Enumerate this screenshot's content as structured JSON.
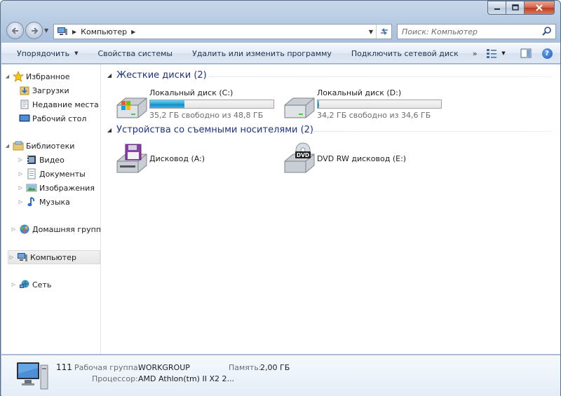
{
  "window": {
    "caption_buttons": [
      "minimize",
      "maximize",
      "close"
    ]
  },
  "address_bar": {
    "crumbs": [
      "Компьютер"
    ]
  },
  "search": {
    "placeholder": "Поиск: Компьютер"
  },
  "toolbar": {
    "organize": "Упорядочить",
    "system_properties": "Свойства системы",
    "uninstall": "Удалить или изменить программу",
    "map_drive": "Подключить сетевой диск",
    "more": "»"
  },
  "nav_pane": {
    "favorites": {
      "label": "Избранное",
      "items": [
        "Загрузки",
        "Недавние места",
        "Рабочий стол"
      ]
    },
    "libraries": {
      "label": "Библиотеки",
      "items": [
        "Видео",
        "Документы",
        "Изображения",
        "Музыка"
      ]
    },
    "homegroup": "Домашняя группа",
    "computer": "Компьютер",
    "network": "Сеть"
  },
  "groups": {
    "hard_disks": {
      "title": "Жесткие диски (2)",
      "drives": [
        {
          "name": "Локальный диск (C:)",
          "free": "35,2 ГБ свободно из 48,8 ГБ",
          "used_fraction": 0.28
        },
        {
          "name": "Локальный диск (D:)",
          "free": "34,2 ГБ свободно из 34,6 ГБ",
          "used_fraction": 0.012
        }
      ]
    },
    "removable": {
      "title": "Устройства со съемными носителями (2)",
      "drives": [
        {
          "name": "Дисковод (A:)"
        },
        {
          "name": "DVD RW дисковод (E:)",
          "badge": "DVD"
        }
      ]
    }
  },
  "details": {
    "computer_name": "111",
    "workgroup_label": "Рабочая группа:",
    "workgroup_value": "WORKGROUP",
    "memory_label": "Память:",
    "memory_value": "2,00 ГБ",
    "processor_label": "Процессор:",
    "processor_value": "AMD Athlon(tm) II X2 2..."
  },
  "colors": {
    "group_header": "#1e3287",
    "bar_fill": "#27a3d9",
    "toolbar_text": "#1e3450"
  }
}
